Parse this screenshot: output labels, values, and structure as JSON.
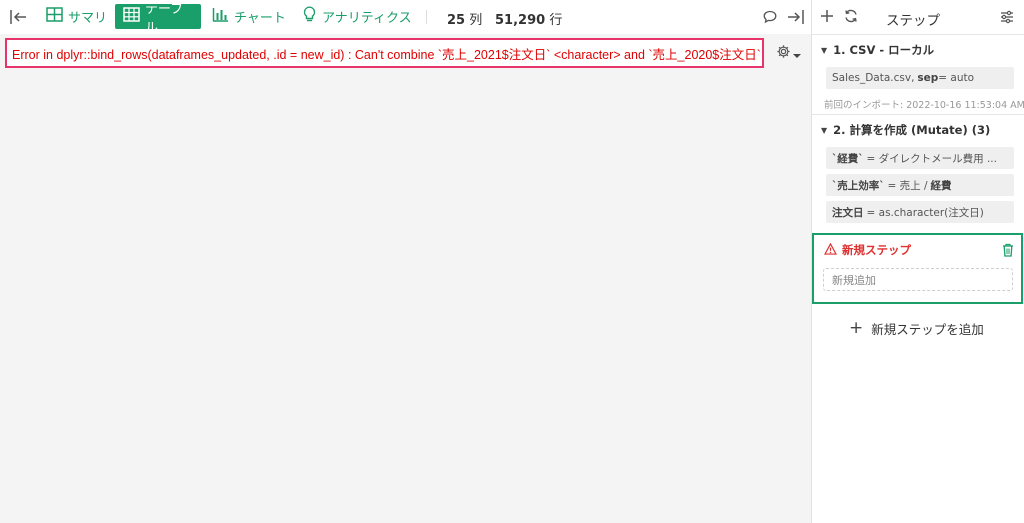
{
  "toolbar": {
    "tabs": [
      {
        "label": "サマリ",
        "icon": "summary-grid-icon"
      },
      {
        "label": "テーブル",
        "icon": "table-icon",
        "active": true
      },
      {
        "label": "チャート",
        "icon": "bar-chart-icon"
      },
      {
        "label": "アナリティクス",
        "icon": "lightbulb-icon"
      }
    ],
    "columns_count": "25",
    "columns_unit": "列",
    "rows_count": "51,290",
    "rows_unit": "行",
    "icons": [
      "collapse-left-icon",
      "comment-icon",
      "collapse-right-icon"
    ]
  },
  "error": {
    "message": "Error in dplyr::bind_rows(dataframes_updated, .id = new_id) : Can't combine `売上_2021$注文日` <character> and `売上_2020$注文日`"
  },
  "panel": {
    "title": "ステップ",
    "steps": [
      {
        "title": "1. CSV - ローカル",
        "chips": [
          {
            "text": "Sales_Data.csv,",
            "key": "sep",
            "value": " = auto"
          }
        ],
        "meta": "前回のインポート: 2022-10-16 11:53:04 AM"
      },
      {
        "title": "2. 計算を作成 (Mutate) (3)",
        "chips": [
          {
            "key": "`経費`",
            "value": "= ダイレクトメール費用 ..."
          },
          {
            "key": "`売上効率`",
            "value": "= 売上 /",
            "key2": "経費"
          },
          {
            "key": "注文日",
            "value": "= as.character(注文日)"
          }
        ]
      }
    ],
    "new_step": {
      "title": "新規ステップ",
      "placeholder": "新規追加"
    },
    "add_step_label": "新規ステップを追加"
  },
  "colors": {
    "accent": "#1a9e6a",
    "error_text": "#e00000",
    "error_border": "#e8336b",
    "warning": "#e03030"
  }
}
